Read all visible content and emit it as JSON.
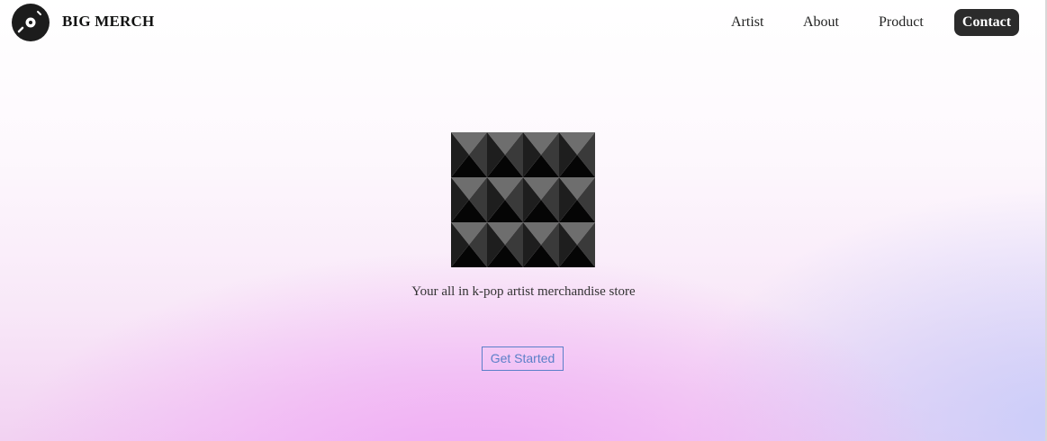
{
  "header": {
    "brand_name": "BIG MERCH",
    "logo_icon": "vinyl-record-icon",
    "nav": [
      {
        "label": "Artist"
      },
      {
        "label": "About"
      },
      {
        "label": "Product"
      },
      {
        "label": "Contact",
        "highlighted": true
      }
    ]
  },
  "hero": {
    "image": "pyramid-stud-pattern",
    "tagline": "Your all in k-pop artist merchandise store",
    "cta_label": "Get Started"
  },
  "colors": {
    "contact_bg": "#2b2b2b",
    "cta_accent": "#5b7fc8",
    "gradient_pink": "#f0aaf5",
    "gradient_blue": "#c8cdfa"
  }
}
